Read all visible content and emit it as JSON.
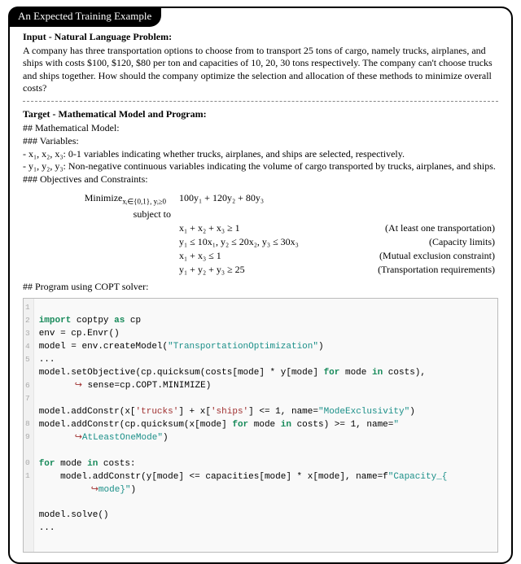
{
  "tab_label": "An Expected Training Example",
  "input": {
    "heading": "Input - Natural Language Problem:",
    "text": "A company has three transportation options to choose from to transport 25 tons of cargo, namely trucks, airplanes, and ships with costs $100, $120, $80 per ton and capacities of 10, 20, 30 tons respectively. The company can't choose trucks and ships together. How should the company optimize the selection and allocation of these methods to minimize overall costs?"
  },
  "target": {
    "heading": "Target - Mathematical Model and Program:",
    "model_h": "## Mathematical Model:",
    "vars_h": "### Variables:",
    "var1": "- x₁, x₂, x₃: 0-1 variables indicating whether trucks, airplanes, and ships are selected, respectively.",
    "var2": "- y₁, y₂, y₃: Non-negative continuous variables indicating the volume of cargo transported by trucks, airplanes, and ships.",
    "obj_h": "### Objectives and Constraints:",
    "math": {
      "min_label": "Minimize",
      "min_sub": "xᵢ∈{0,1}, yᵢ≥0",
      "obj_expr": "100y₁ + 120y₂ + 80y₃",
      "st": "subject to",
      "c1_expr": "x₁ + x₂ + x₃ ≥ 1",
      "c1_tag": "(At least one transportation)",
      "c2_expr": "y₁ ≤ 10x₁,    y₂ ≤ 20x₂,    y₃ ≤ 30x₃",
      "c2_tag": "(Capacity limits)",
      "c3_expr": "x₁ + x₃ ≤ 1",
      "c3_tag": "(Mutual exclusion constraint)",
      "c4_expr": "y₁ + y₂ + y₃ ≥ 25",
      "c4_tag": "(Transportation requirements)"
    },
    "prog_h": "## Program using COPT solver:",
    "code": {
      "l1_kw1": "import",
      "l1_rest": " coptpy ",
      "l1_kw2": "as",
      "l1_rest2": " cp",
      "l2": "env = cp.Envr()",
      "l3a": "model = env.createModel(",
      "l3s": "\"TransportationOptimization\"",
      "l3b": ")",
      "l4": "...",
      "l5a": "model.setObjective(cp.quicksum(costs[mode] * y[mode] ",
      "l5kw": "for",
      "l5b": " mode ",
      "l5kw2": "in",
      "l5c": " costs),",
      "l5cont_arrow": "↪",
      "l5cont": " sense=cp.COPT.MINIMIZE)",
      "l6a": "model.addConstr(x[",
      "l6s1": "'trucks'",
      "l6b": "] + x[",
      "l6s2": "'ships'",
      "l6c": "] <= 1, name=",
      "l6s3": "\"ModeExclusivity\"",
      "l6d": ")",
      "l7a": "model.addConstr(cp.quicksum(x[mode] ",
      "l7kw": "for",
      "l7b": " mode ",
      "l7kw2": "in",
      "l7c": " costs) >= 1, name=",
      "l7s": "\"",
      "l7cont_arrow": "↪",
      "l7cont_s": "AtLeastOneMode\"",
      "l7cont_b": ")",
      "l8kw": "for",
      "l8a": " mode ",
      "l8kw2": "in",
      "l8b": " costs:",
      "l9a": "    model.addConstr(y[mode] <= capacities[mode] * x[mode], name=f",
      "l9s": "\"Capacity_{",
      "l9cont_arrow": "↪",
      "l9cont_s": "mode}\"",
      "l9cont_b": ")",
      "l10": "model.solve()",
      "l11": "..."
    },
    "gutter": [
      "1",
      "2",
      "3",
      "4",
      "5",
      "",
      "6",
      "7",
      "",
      "8",
      "9",
      "",
      "0",
      "1"
    ]
  }
}
